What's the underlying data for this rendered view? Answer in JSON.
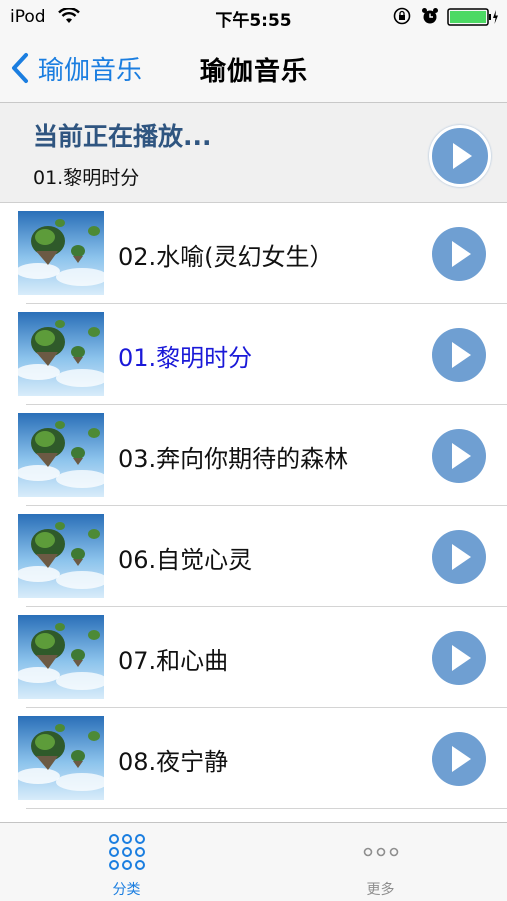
{
  "status_bar": {
    "carrier": "iPod",
    "time": "下午5:55"
  },
  "nav": {
    "back_label": "瑜伽音乐",
    "title": "瑜伽音乐"
  },
  "now_playing": {
    "heading": "当前正在播放...",
    "track": "01.黎明时分"
  },
  "songs": [
    {
      "title": "02.水喻(灵幻女生）",
      "active": false
    },
    {
      "title": "01.黎明时分",
      "active": true
    },
    {
      "title": "03.奔向你期待的森林",
      "active": false
    },
    {
      "title": "06.自觉心灵",
      "active": false
    },
    {
      "title": "07.和心曲",
      "active": false
    },
    {
      "title": "08.夜宁静",
      "active": false
    }
  ],
  "tabs": [
    {
      "label": "分类",
      "icon": "grid-dots-icon",
      "active": true
    },
    {
      "label": "更多",
      "icon": "more-dots-icon",
      "active": false
    }
  ],
  "colors": {
    "accent": "#1b7ee0",
    "play_button": "#6f9fd2",
    "active_track": "#1a19d8",
    "now_playing_heading": "#2f5580"
  }
}
